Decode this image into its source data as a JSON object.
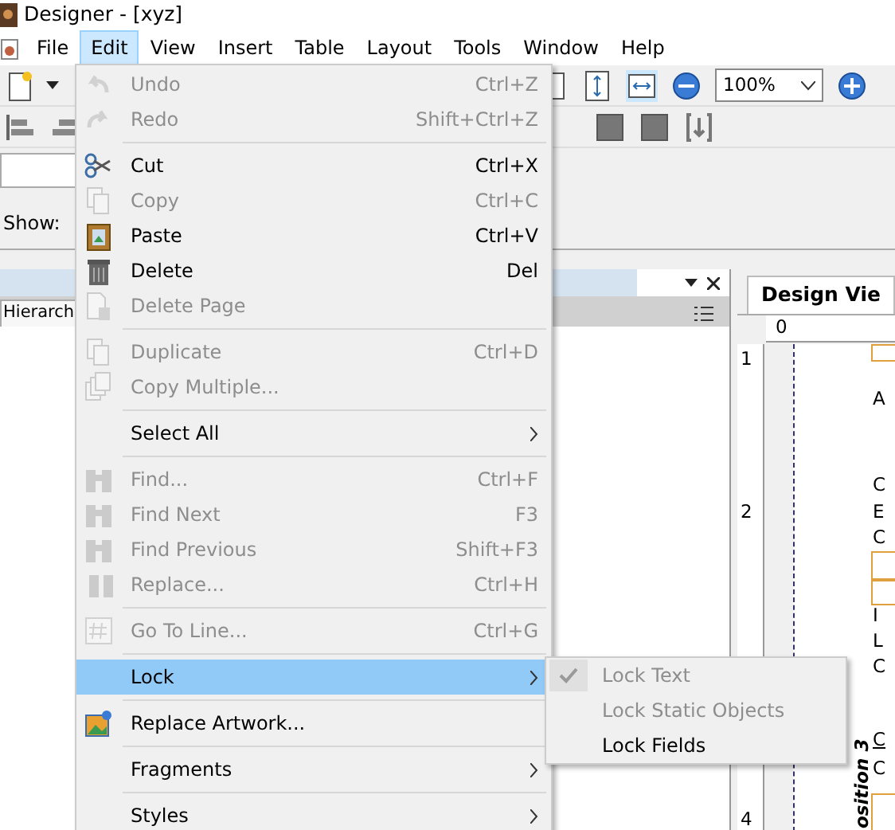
{
  "window": {
    "title": "Designer - [xyz]"
  },
  "menubar": [
    {
      "label": "File",
      "selected": false
    },
    {
      "label": "Edit",
      "selected": true
    },
    {
      "label": "View",
      "selected": false
    },
    {
      "label": "Insert",
      "selected": false
    },
    {
      "label": "Table",
      "selected": false
    },
    {
      "label": "Layout",
      "selected": false
    },
    {
      "label": "Tools",
      "selected": false
    },
    {
      "label": "Window",
      "selected": false
    },
    {
      "label": "Help",
      "selected": false
    }
  ],
  "toolbar": {
    "zoom": "100%"
  },
  "left_panel": {
    "show_label": "Show:",
    "tab": "Hierarch"
  },
  "design_view": {
    "tab": "Design Vie",
    "ruler_h": [
      "0"
    ],
    "ruler_v": [
      "1",
      "2",
      "4"
    ],
    "doc_letters": [
      "A",
      "C",
      "E",
      "C",
      "I",
      "L",
      "C",
      "C",
      "C"
    ],
    "vertical_text": "osition 3"
  },
  "edit_menu": [
    {
      "kind": "item",
      "label": "Undo",
      "shortcut": "Ctrl+Z",
      "disabled": true,
      "submenu": false,
      "selected": false
    },
    {
      "kind": "item",
      "label": "Redo",
      "shortcut": "Shift+Ctrl+Z",
      "disabled": true,
      "submenu": false,
      "selected": false
    },
    {
      "kind": "separator"
    },
    {
      "kind": "item",
      "label": "Cut",
      "shortcut": "Ctrl+X",
      "disabled": false,
      "submenu": false,
      "selected": false
    },
    {
      "kind": "item",
      "label": "Copy",
      "shortcut": "Ctrl+C",
      "disabled": true,
      "submenu": false,
      "selected": false
    },
    {
      "kind": "item",
      "label": "Paste",
      "shortcut": "Ctrl+V",
      "disabled": false,
      "submenu": false,
      "selected": false
    },
    {
      "kind": "item",
      "label": "Delete",
      "shortcut": "Del",
      "disabled": false,
      "submenu": false,
      "selected": false
    },
    {
      "kind": "item",
      "label": "Delete Page",
      "disabled": true,
      "submenu": false,
      "selected": false
    },
    {
      "kind": "separator"
    },
    {
      "kind": "item",
      "label": "Duplicate",
      "shortcut": "Ctrl+D",
      "disabled": true,
      "submenu": false,
      "selected": false
    },
    {
      "kind": "item",
      "label": "Copy Multiple...",
      "disabled": true,
      "submenu": false,
      "selected": false
    },
    {
      "kind": "separator"
    },
    {
      "kind": "item",
      "label": "Select All",
      "disabled": false,
      "submenu": true,
      "selected": false
    },
    {
      "kind": "separator"
    },
    {
      "kind": "item",
      "label": "Find...",
      "shortcut": "Ctrl+F",
      "disabled": true,
      "submenu": false,
      "selected": false
    },
    {
      "kind": "item",
      "label": "Find Next",
      "shortcut": "F3",
      "disabled": true,
      "submenu": false,
      "selected": false
    },
    {
      "kind": "item",
      "label": "Find Previous",
      "shortcut": "Shift+F3",
      "disabled": true,
      "submenu": false,
      "selected": false
    },
    {
      "kind": "item",
      "label": "Replace...",
      "shortcut": "Ctrl+H",
      "disabled": true,
      "submenu": false,
      "selected": false
    },
    {
      "kind": "separator"
    },
    {
      "kind": "item",
      "label": "Go To Line...",
      "shortcut": "Ctrl+G",
      "disabled": true,
      "submenu": false,
      "selected": false
    },
    {
      "kind": "separator"
    },
    {
      "kind": "item",
      "label": "Lock",
      "disabled": false,
      "submenu": true,
      "selected": true
    },
    {
      "kind": "separator"
    },
    {
      "kind": "item",
      "label": "Replace Artwork...",
      "disabled": false,
      "submenu": false,
      "selected": false
    },
    {
      "kind": "separator"
    },
    {
      "kind": "item",
      "label": "Fragments",
      "disabled": false,
      "submenu": true,
      "selected": false
    },
    {
      "kind": "separator"
    },
    {
      "kind": "item",
      "label": "Styles",
      "disabled": false,
      "submenu": true,
      "selected": false
    }
  ],
  "lock_submenu": [
    {
      "label": "Lock Text",
      "checked": true,
      "disabled": true
    },
    {
      "label": "Lock Static Objects",
      "checked": false,
      "disabled": true
    },
    {
      "label": "Lock Fields",
      "checked": false,
      "disabled": false
    }
  ]
}
